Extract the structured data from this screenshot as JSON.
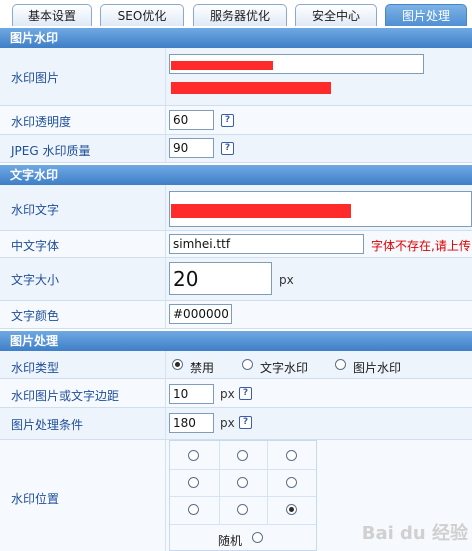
{
  "tabs": [
    {
      "label": "基本设置"
    },
    {
      "label": "SEO优化"
    },
    {
      "label": "服务器优化"
    },
    {
      "label": "安全中心"
    },
    {
      "label": "图片处理"
    }
  ],
  "sections": {
    "image_watermark": "图片水印",
    "text_watermark": "文字水印",
    "image_processing": "图片处理"
  },
  "fields": {
    "watermark_image": {
      "label": "水印图片",
      "value": ""
    },
    "watermark_opacity": {
      "label": "水印透明度",
      "value": "60"
    },
    "jpeg_quality": {
      "label": "JPEG 水印质量",
      "value": "90"
    },
    "watermark_text": {
      "label": "水印文字",
      "value": ""
    },
    "chinese_font": {
      "label": "中文字体",
      "value": "simhei.ttf",
      "warning": "字体不存在,请上传"
    },
    "text_size": {
      "label": "文字大小",
      "value": "20",
      "unit": "px"
    },
    "text_color": {
      "label": "文字颜色",
      "value": "#000000"
    },
    "watermark_type": {
      "label": "水印类型",
      "options": [
        "禁用",
        "文字水印",
        "图片水印"
      ],
      "selected": "禁用"
    },
    "margin": {
      "label": "水印图片或文字边距",
      "value": "10",
      "unit": "px"
    },
    "condition": {
      "label": "图片处理条件",
      "value": "180",
      "unit": "px"
    },
    "position": {
      "label": "水印位置",
      "random_label": "随机",
      "selected_cell": 9
    }
  },
  "help_glyph": "?",
  "watermark_text_overlay": "Bai du 经验",
  "colors": {
    "header": "#3f7fc7",
    "label": "#1f4f9b",
    "warning": "#e00000",
    "redaction": "#ff2a2a"
  }
}
